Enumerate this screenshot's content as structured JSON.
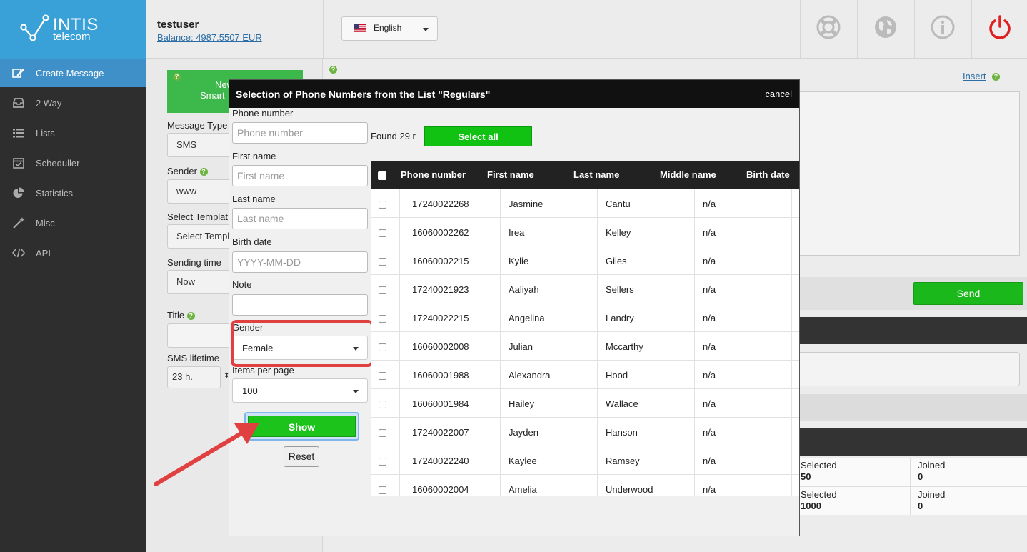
{
  "brand": {
    "name_line1": "INTIS",
    "name_line2": "telecom"
  },
  "sidebar": {
    "items": [
      {
        "label": "Create Message",
        "icon": "edit-icon",
        "active": true
      },
      {
        "label": "2 Way",
        "icon": "inbox-icon"
      },
      {
        "label": "Lists",
        "icon": "list-icon"
      },
      {
        "label": "Scheduller",
        "icon": "calendar-icon"
      },
      {
        "label": "Statistics",
        "icon": "pie-chart-icon"
      },
      {
        "label": "Misc.",
        "icon": "magic-wand-icon"
      },
      {
        "label": "API",
        "icon": "code-icon"
      }
    ]
  },
  "header": {
    "user": "testuser",
    "balance": "Balance: 4987.5507 EUR",
    "language": "English",
    "icons": [
      "lifebuoy-icon",
      "globe-icon",
      "info-icon",
      "power-icon"
    ]
  },
  "compose": {
    "promo_line1": "New",
    "promo_line2": "Smart",
    "message_type_label": "Message Type",
    "message_type_value": "SMS",
    "sender_label": "Sender",
    "sender_value": "www",
    "template_label": "Select Templat",
    "template_value": "Select Templ",
    "sending_time_label": "Sending time",
    "sending_time_value": "Now",
    "title_label": "Title",
    "title_value": "",
    "lifetime_label": "SMS lifetime",
    "lifetime_value": "23 h.",
    "insert_link": "Insert",
    "send_button": "Send"
  },
  "stats": [
    {
      "selected_label": "Selected",
      "selected_value": "50",
      "joined_label": "Joined",
      "joined_value": "0"
    },
    {
      "selected_label": "Selected",
      "selected_value": "1000",
      "joined_label": "Joined",
      "joined_value": "0"
    }
  ],
  "modal": {
    "title": "Selection of Phone Numbers from the List \"Regulars\"",
    "cancel": "cancel",
    "filters": {
      "phone_label": "Phone number",
      "phone_placeholder": "Phone number",
      "first_label": "First name",
      "first_placeholder": "First name",
      "last_label": "Last name",
      "last_placeholder": "Last name",
      "birth_label": "Birth date",
      "birth_placeholder": "YYYY-MM-DD",
      "note_label": "Note",
      "note_value": "",
      "gender_label": "Gender",
      "gender_value": "Female",
      "items_label": "Items per page",
      "items_value": "100"
    },
    "show_button": "Show",
    "reset_button": "Reset",
    "found_text": "Found 29 r",
    "select_all": "Select all",
    "columns": [
      "Phone number",
      "First name",
      "Last name",
      "Middle name",
      "Birth date"
    ],
    "rows": [
      {
        "phone": "17240022268",
        "first": "Jasmine",
        "last": "Cantu",
        "middle": "n/a"
      },
      {
        "phone": "16060002262",
        "first": "Irea",
        "last": "Kelley",
        "middle": "n/a"
      },
      {
        "phone": "16060002215",
        "first": "Kylie",
        "last": "Giles",
        "middle": "n/a"
      },
      {
        "phone": "17240021923",
        "first": "Aaliyah",
        "last": "Sellers",
        "middle": "n/a"
      },
      {
        "phone": "17240022215",
        "first": "Angelina",
        "last": "Landry",
        "middle": "n/a"
      },
      {
        "phone": "16060002008",
        "first": "Julian",
        "last": "Mccarthy",
        "middle": "n/a"
      },
      {
        "phone": "16060001988",
        "first": "Alexandra",
        "last": "Hood",
        "middle": "n/a"
      },
      {
        "phone": "16060001984",
        "first": "Hailey",
        "last": "Wallace",
        "middle": "n/a"
      },
      {
        "phone": "17240022007",
        "first": "Jayden",
        "last": "Hanson",
        "middle": "n/a"
      },
      {
        "phone": "17240022240",
        "first": "Kaylee",
        "last": "Ramsey",
        "middle": "n/a"
      },
      {
        "phone": "16060002004",
        "first": "Amelia",
        "last": "Underwood",
        "middle": "n/a"
      }
    ]
  },
  "colors": {
    "brand_blue": "#3aa0d8",
    "active_nav": "#3f8fc8",
    "green": "#1bb81b",
    "annotation_red": "#e04040",
    "power_red": "#e02020"
  }
}
